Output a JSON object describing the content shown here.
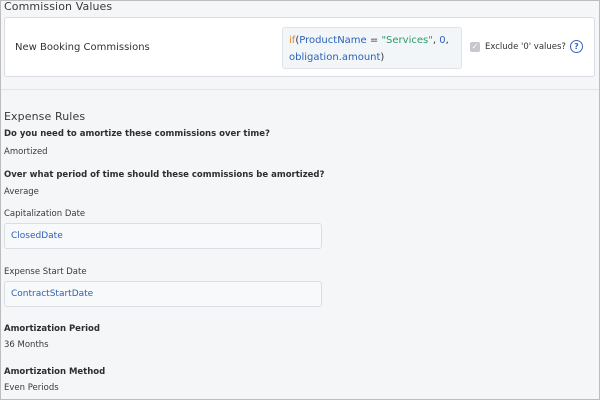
{
  "commission_values": {
    "title": "Commission Values",
    "row_label": "New Booking Commissions",
    "formula": {
      "fn": "if",
      "open": "(",
      "field": "ProductName",
      "op": " = ",
      "string": "\"Services\"",
      "comma1": ", ",
      "zero": "0",
      "comma2": ",",
      "field2": "obligation.amount",
      "close": ")"
    },
    "exclude_label": "Exclude '0' values?",
    "exclude_checked": true
  },
  "expense_rules": {
    "title": "Expense Rules",
    "q1": "Do you need to amortize these commissions over time?",
    "a1": "Amortized",
    "q2": "Over what period of time should these commissions be amortized?",
    "a2": "Average",
    "cap_date_label": "Capitalization Date",
    "cap_date_value": "ClosedDate",
    "expense_start_label": "Expense Start Date",
    "expense_start_value": "ContractStartDate",
    "amort_period_label": "Amortization Period",
    "amort_period_value": "36 Months",
    "amort_method_label": "Amortization Method",
    "amort_method_value": "Even Periods"
  },
  "colors": {
    "accent": "#3b63c4",
    "function": "#e3831e",
    "string": "#2f9a63",
    "field": "#2c61b8"
  }
}
